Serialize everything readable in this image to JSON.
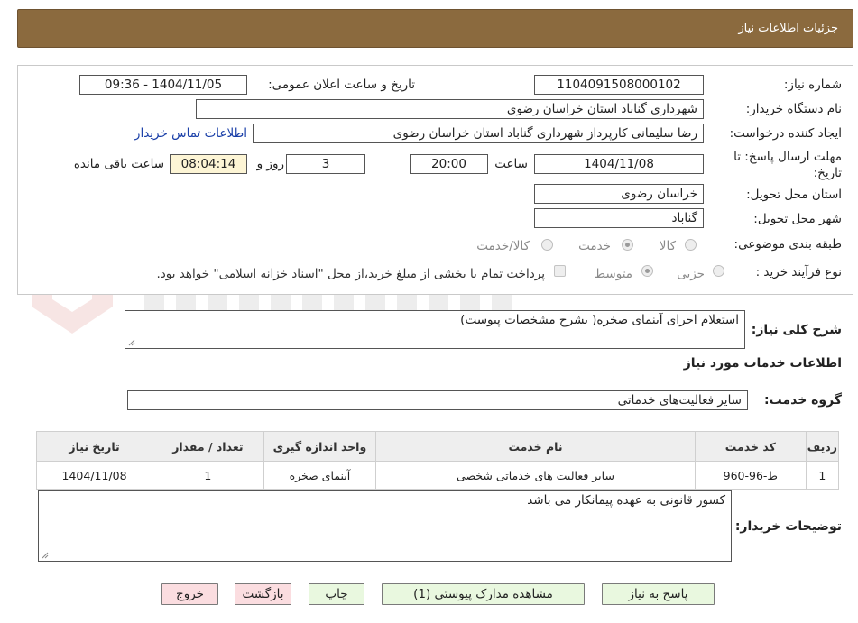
{
  "header": {
    "title": "جزئیات اطلاعات نیاز"
  },
  "form": {
    "need_number_label": "شماره نیاز:",
    "need_number": "1104091508000102",
    "announce_label": "تاریخ و ساعت اعلان عمومی:",
    "announce_value": "1404/11/05 - 09:36",
    "buyer_org_label": "نام دستگاه خریدار:",
    "buyer_org": "شهرداری گناباد استان خراسان رضوی",
    "creator_label": "ایجاد کننده درخواست:",
    "creator": "رضا سلیمانی کارپرداز شهرداری گناباد استان خراسان رضوی",
    "contact_link": "اطلاعات تماس خریدار",
    "deadline_label_1": "مهلت ارسال پاسخ: تا",
    "deadline_label_2": "تاریخ:",
    "deadline_date": "1404/11/08",
    "time_label": "ساعت",
    "deadline_time": "20:00",
    "days_value": "3",
    "days_label": "روز و",
    "remaining_time": "08:04:14",
    "remaining_label": "ساعت باقی مانده",
    "province_label": "استان محل تحویل:",
    "province": "خراسان رضوی",
    "city_label": "شهر محل تحویل:",
    "city": "گناباد",
    "category_label": "طبقه بندی موضوعی:",
    "category_options": [
      "کالا",
      "خدمت",
      "کالا/خدمت"
    ],
    "category_selected": "خدمت",
    "process_label": "نوع فرآیند خرید :",
    "process_options": [
      "جزیی",
      "متوسط"
    ],
    "process_selected": "متوسط",
    "payment_note": "پرداخت تمام یا بخشی از مبلغ خرید،از محل \"اسناد خزانه اسلامی\" خواهد بود."
  },
  "summary": {
    "label": "شرح کلی نیاز:",
    "value": "استعلام اجرای آبنمای صخره( بشرح مشخصات پیوست)"
  },
  "services": {
    "section_title": "اطلاعات خدمات مورد نیاز",
    "group_label": "گروه خدمت:",
    "group_value": "سایر فعالیت‌های خدماتی",
    "columns": [
      "ردیف",
      "کد خدمت",
      "نام خدمت",
      "واحد اندازه گیری",
      "تعداد / مقدار",
      "تاریخ نیاز"
    ],
    "rows": [
      [
        "1",
        "ط-96-960",
        "سایر فعالیت های خدماتی شخصی",
        "آبنمای صخره",
        "1",
        "1404/11/08"
      ]
    ]
  },
  "buyer_notes": {
    "label": "توضیحات خریدار:",
    "value": "کسور قانونی به عهده پیمانکار می باشد"
  },
  "buttons": {
    "respond": "پاسخ به نیاز",
    "attachments": "مشاهده مدارک پیوستی (1)",
    "print": "چاپ",
    "back": "بازگشت",
    "exit": "خروج"
  },
  "colors": {
    "title_bar": "#8b6a3e",
    "green_button": "#e9f8df",
    "pink_button": "#fbdde0",
    "remaining_box": "#fdf5d5",
    "link": "#1a3fa8"
  }
}
